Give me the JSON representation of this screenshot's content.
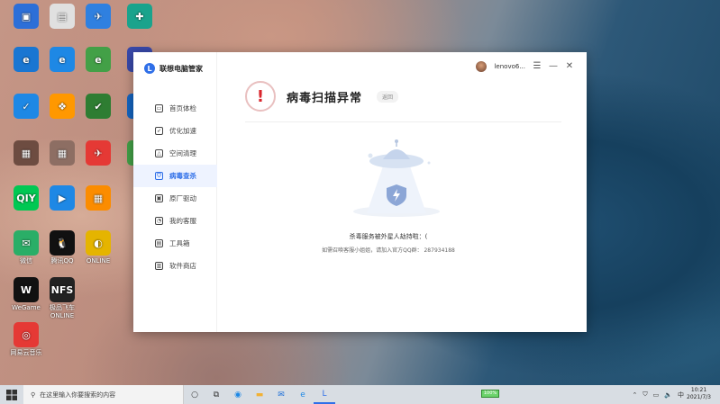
{
  "desktop": {
    "icons": [
      {
        "label": "",
        "color": "#2d6fd8",
        "glyph": "▣"
      },
      {
        "label": "",
        "color": "#e0e0e0",
        "glyph": "▤"
      },
      {
        "label": "",
        "color": "#2f80e0",
        "glyph": "✈"
      },
      {
        "label": "",
        "color": "#1aa38c",
        "glyph": "✚"
      },
      {
        "label": "",
        "color": "#1976d2",
        "glyph": "e"
      },
      {
        "label": "",
        "color": "#1e88e5",
        "glyph": "e"
      },
      {
        "label": "",
        "color": "#43a047",
        "glyph": "e"
      },
      {
        "label": "",
        "color": "#3949ab",
        "glyph": "✈"
      },
      {
        "label": "",
        "color": "#1e88e5",
        "glyph": "✓"
      },
      {
        "label": "",
        "color": "#ff9800",
        "glyph": "❖"
      },
      {
        "label": "",
        "color": "#2e7d32",
        "glyph": "✔"
      },
      {
        "label": "",
        "color": "#1565c0",
        "glyph": "⛊"
      },
      {
        "label": "",
        "color": "#6d4c41",
        "glyph": "▦"
      },
      {
        "label": "",
        "color": "#8d6e63",
        "glyph": "▦"
      },
      {
        "label": "",
        "color": "#e53935",
        "glyph": "✈"
      },
      {
        "label": "",
        "color": "#43a047",
        "glyph": "e"
      },
      {
        "label": "",
        "color": "#00c853",
        "glyph": "QIY"
      },
      {
        "label": "",
        "color": "#1e88e5",
        "glyph": "▶"
      },
      {
        "label": "",
        "color": "#fb8c00",
        "glyph": "▦"
      },
      {
        "label": "微信",
        "color": "#2aae67",
        "glyph": "✉"
      },
      {
        "label": "腾讯QQ",
        "color": "#111111",
        "glyph": "🐧"
      },
      {
        "label": "ONLINE",
        "color": "#e5b400",
        "glyph": "◐"
      },
      {
        "label": "WeGame",
        "color": "#111111",
        "glyph": "W"
      },
      {
        "label": "极品飞车 ONLINE",
        "color": "#222222",
        "glyph": "NFS"
      },
      {
        "label": "网易云音乐",
        "color": "#e53935",
        "glyph": "◎"
      }
    ]
  },
  "window": {
    "app_title": "联想电脑管家",
    "user_name": "lenovo6...",
    "controls": {
      "menu": "☰",
      "minimize": "—",
      "close": "✕"
    },
    "nav": [
      {
        "label": "首页体检",
        "icon": "▭"
      },
      {
        "label": "优化加速",
        "icon": "➶"
      },
      {
        "label": "空间清理",
        "icon": "△"
      },
      {
        "label": "病毒查杀",
        "icon": "⛉",
        "active": true
      },
      {
        "label": "原厂驱动",
        "icon": "▣"
      },
      {
        "label": "我的客服",
        "icon": "◔"
      },
      {
        "label": "工具箱",
        "icon": "▤"
      },
      {
        "label": "软件商店",
        "icon": "▥"
      }
    ],
    "page_title": "病毒扫描异常",
    "back_label": "返回",
    "message": "杀毒服务被外星人劫持啦：(",
    "help": "如需召唤客服小姐姐，请加入官方QQ群：  287934188"
  },
  "taskbar": {
    "search_placeholder": "在这里输入你要搜索的内容",
    "battery": "100%",
    "ime": "中",
    "time": "10:21",
    "date": "2021/7/3"
  }
}
